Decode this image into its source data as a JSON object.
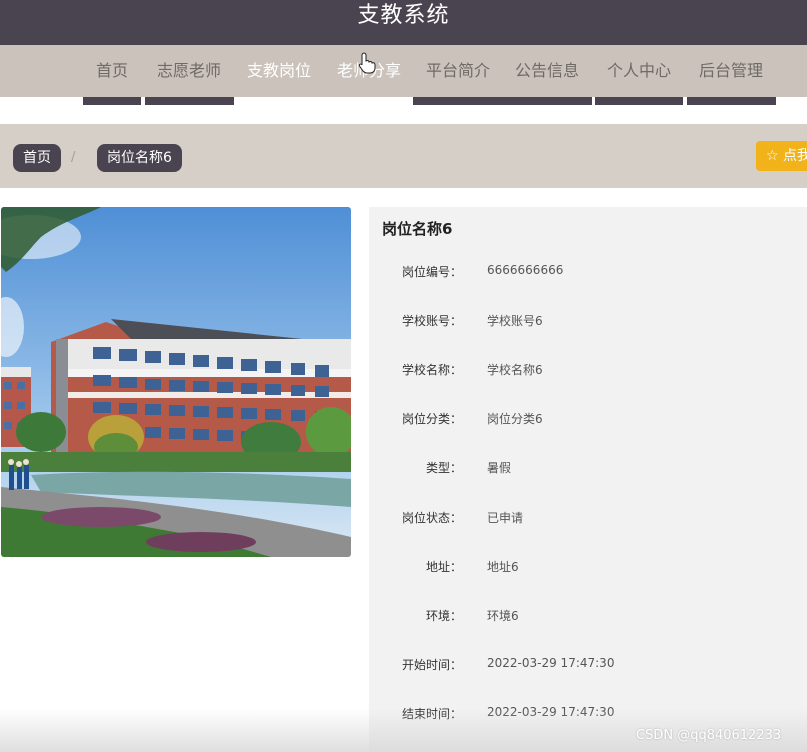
{
  "header": {
    "site_title": "支教系统"
  },
  "nav": {
    "items": [
      {
        "label": "首页"
      },
      {
        "label": "志愿老师"
      },
      {
        "label": "支教岗位"
      },
      {
        "label": "老师分享"
      },
      {
        "label": "平台简介"
      },
      {
        "label": "公告信息"
      },
      {
        "label": "个人中心"
      },
      {
        "label": "后台管理"
      }
    ],
    "active_index": 2
  },
  "breadcrumb": {
    "home": "首页",
    "separator": "/",
    "current": "岗位名称6"
  },
  "favorite_button": {
    "label": "☆ 点我收藏"
  },
  "detail": {
    "title": "岗位名称6",
    "rows": [
      {
        "label": "岗位编号：",
        "value": "6666666666"
      },
      {
        "label": "学校账号：",
        "value": "学校账号6"
      },
      {
        "label": "学校名称：",
        "value": "学校名称6"
      },
      {
        "label": "岗位分类：",
        "value": "岗位分类6"
      },
      {
        "label": "类型：",
        "value": "暑假"
      },
      {
        "label": "岗位状态：",
        "value": "已申请"
      },
      {
        "label": "地址：",
        "value": "地址6"
      },
      {
        "label": "环境：",
        "value": "环境6"
      },
      {
        "label": "开始时间：",
        "value": "2022-03-29 17:47:30"
      },
      {
        "label": "结束时间：",
        "value": "2022-03-29 17:47:30"
      }
    ]
  },
  "watermark": "CSDN @qq840612233",
  "colors": {
    "header_bg": "#4a4450",
    "nav_bg": "#cbc3bb",
    "breadcrumb_bg": "#d6cfc7",
    "accent": "#f2b31a",
    "panel_bg": "#f2f2f2"
  }
}
